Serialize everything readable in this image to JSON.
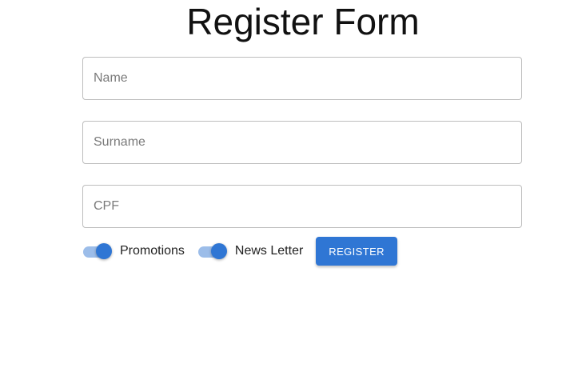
{
  "header": {
    "title": "Register Form"
  },
  "form": {
    "fields": [
      {
        "placeholder": "Name",
        "value": ""
      },
      {
        "placeholder": "Surname",
        "value": ""
      },
      {
        "placeholder": "CPF",
        "value": ""
      }
    ],
    "switches": [
      {
        "label": "Promotions",
        "checked": true
      },
      {
        "label": "News Letter",
        "checked": true
      }
    ],
    "submit_label": "REGISTER"
  },
  "colors": {
    "accent": "#2f76d4",
    "switch_track": "#9cbde9",
    "field_border": "#bdbdbd"
  }
}
